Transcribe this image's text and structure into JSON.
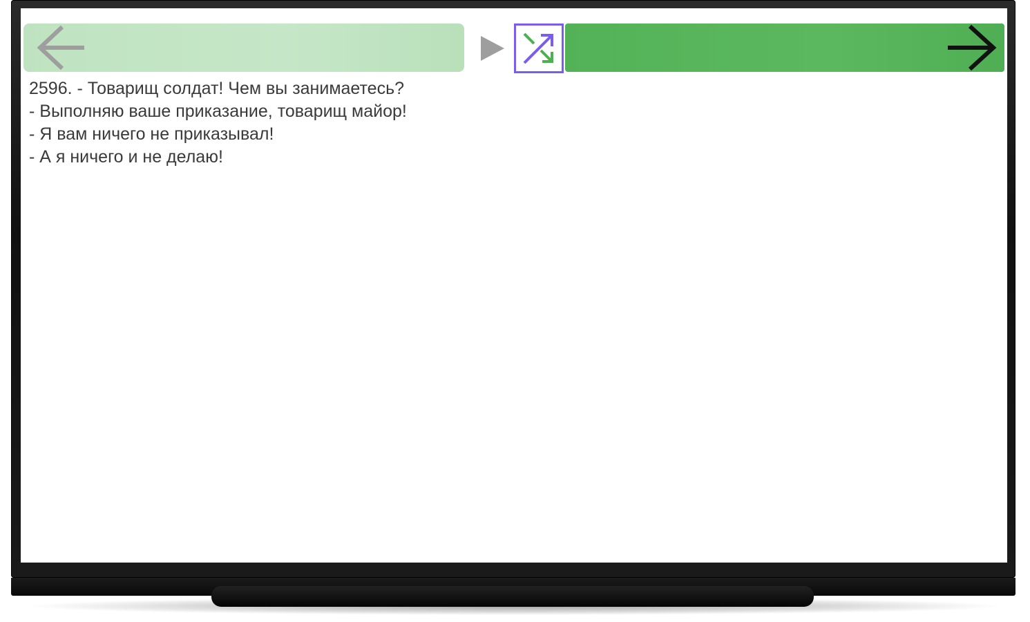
{
  "navigation": {
    "prev_icon": "arrow-left-icon",
    "next_icon": "arrow-right-icon",
    "play_icon": "play-triangle-icon",
    "shuffle_icon": "shuffle-icon"
  },
  "colors": {
    "prev_button": "#c3e5c4",
    "next_button": "#57b35a",
    "shuffle_border": "#7b5cf0",
    "shuffle_arrows": "#4caf50",
    "text": "#3a3a3a"
  },
  "joke": {
    "lines": [
      "2596. - Товарищ солдат! Чем вы занимаетесь?",
      "- Выполняю ваше приказание, товарищ майор!",
      "- Я вам ничего не приказывал!",
      "- А я ничего и не делаю!"
    ]
  }
}
